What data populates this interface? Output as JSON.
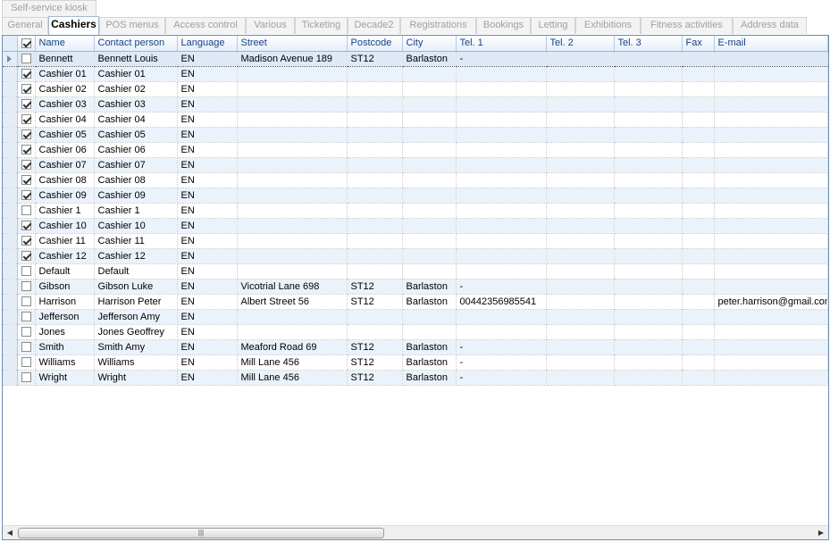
{
  "tabs_row1": [
    {
      "label": "Self-service kiosk"
    }
  ],
  "tabs_row2": [
    {
      "label": "General"
    },
    {
      "label": "Cashiers",
      "active": true
    },
    {
      "label": "POS menus"
    },
    {
      "label": "Access control"
    },
    {
      "label": "Various"
    },
    {
      "label": "Ticketing"
    },
    {
      "label": "Decade2"
    },
    {
      "label": "Registrations"
    },
    {
      "label": "Bookings"
    },
    {
      "label": "Letting"
    },
    {
      "label": "Exhibitions"
    },
    {
      "label": "Fitness activities"
    },
    {
      "label": "Address data"
    }
  ],
  "grid": {
    "header_checked": true,
    "columns": [
      "Name",
      "Contact person",
      "Language",
      "Street",
      "Postcode",
      "City",
      "Tel. 1",
      "Tel. 2",
      "Tel. 3",
      "Fax",
      "E-mail"
    ],
    "rows": [
      {
        "checked": false,
        "current": true,
        "cells": [
          "Bennett",
          "Bennett Louis",
          "EN",
          "Madison Avenue  189",
          "ST12",
          "Barlaston",
          "-",
          "",
          "",
          "",
          ""
        ]
      },
      {
        "checked": true,
        "cells": [
          "Cashier 01",
          "Cashier 01",
          "EN",
          "",
          "",
          "",
          "",
          "",
          "",
          "",
          ""
        ]
      },
      {
        "checked": true,
        "cells": [
          "Cashier 02",
          "Cashier 02",
          "EN",
          "",
          "",
          "",
          "",
          "",
          "",
          "",
          ""
        ]
      },
      {
        "checked": true,
        "cells": [
          "Cashier 03",
          "Cashier 03",
          "EN",
          "",
          "",
          "",
          "",
          "",
          "",
          "",
          ""
        ]
      },
      {
        "checked": true,
        "cells": [
          "Cashier 04",
          "Cashier 04",
          "EN",
          "",
          "",
          "",
          "",
          "",
          "",
          "",
          ""
        ]
      },
      {
        "checked": true,
        "cells": [
          "Cashier 05",
          "Cashier 05",
          "EN",
          "",
          "",
          "",
          "",
          "",
          "",
          "",
          ""
        ]
      },
      {
        "checked": true,
        "cells": [
          "Cashier 06",
          "Cashier 06",
          "EN",
          "",
          "",
          "",
          "",
          "",
          "",
          "",
          ""
        ]
      },
      {
        "checked": true,
        "cells": [
          "Cashier 07",
          "Cashier 07",
          "EN",
          "",
          "",
          "",
          "",
          "",
          "",
          "",
          ""
        ]
      },
      {
        "checked": true,
        "cells": [
          "Cashier 08",
          "Cashier 08",
          "EN",
          "",
          "",
          "",
          "",
          "",
          "",
          "",
          ""
        ]
      },
      {
        "checked": true,
        "cells": [
          "Cashier 09",
          "Cashier 09",
          "EN",
          "",
          "",
          "",
          "",
          "",
          "",
          "",
          ""
        ]
      },
      {
        "checked": false,
        "cells": [
          "Cashier 1",
          "Cashier 1",
          "EN",
          "",
          "",
          "",
          "",
          "",
          "",
          "",
          ""
        ]
      },
      {
        "checked": true,
        "cells": [
          "Cashier 10",
          "Cashier 10",
          "EN",
          "",
          "",
          "",
          "",
          "",
          "",
          "",
          ""
        ]
      },
      {
        "checked": true,
        "cells": [
          "Cashier 11",
          "Cashier 11",
          "EN",
          "",
          "",
          "",
          "",
          "",
          "",
          "",
          ""
        ]
      },
      {
        "checked": true,
        "cells": [
          "Cashier 12",
          "Cashier 12",
          "EN",
          "",
          "",
          "",
          "",
          "",
          "",
          "",
          ""
        ]
      },
      {
        "checked": false,
        "cells": [
          "Default",
          "Default",
          "EN",
          "",
          "",
          "",
          "",
          "",
          "",
          "",
          ""
        ]
      },
      {
        "checked": false,
        "cells": [
          "Gibson",
          "Gibson Luke",
          "EN",
          "Vicotrial Lane  698",
          "ST12",
          "Barlaston",
          "-",
          "",
          "",
          "",
          ""
        ]
      },
      {
        "checked": false,
        "cells": [
          "Harrison",
          "Harrison Peter",
          "EN",
          "Albert Street  56",
          "ST12",
          "Barlaston",
          "00442356985541",
          "",
          "",
          "",
          "peter.harrison@gmail.com"
        ]
      },
      {
        "checked": false,
        "cells": [
          "Jefferson",
          "Jefferson Amy",
          "EN",
          "",
          "",
          "",
          "",
          "",
          "",
          "",
          ""
        ]
      },
      {
        "checked": false,
        "cells": [
          "Jones",
          "Jones Geoffrey",
          "EN",
          "",
          "",
          "",
          "",
          "",
          "",
          "",
          ""
        ]
      },
      {
        "checked": false,
        "cells": [
          "Smith",
          "Smith Amy",
          "EN",
          "Meaford Road  69",
          "ST12",
          "Barlaston",
          "-",
          "",
          "",
          "",
          ""
        ]
      },
      {
        "checked": false,
        "cells": [
          "Williams",
          "Williams",
          "EN",
          "Mill Lane  456",
          "ST12",
          "Barlaston",
          "-",
          "",
          "",
          "",
          ""
        ]
      },
      {
        "checked": false,
        "cells": [
          "Wright",
          "Wright",
          "EN",
          "Mill Lane  456",
          "ST12",
          "Barlaston",
          "-",
          "",
          "",
          "",
          ""
        ]
      }
    ]
  },
  "scrollbar": {
    "left_icon": "arrow-left-icon",
    "right_icon": "arrow-right-icon",
    "grip_icon": "grip-icon"
  }
}
